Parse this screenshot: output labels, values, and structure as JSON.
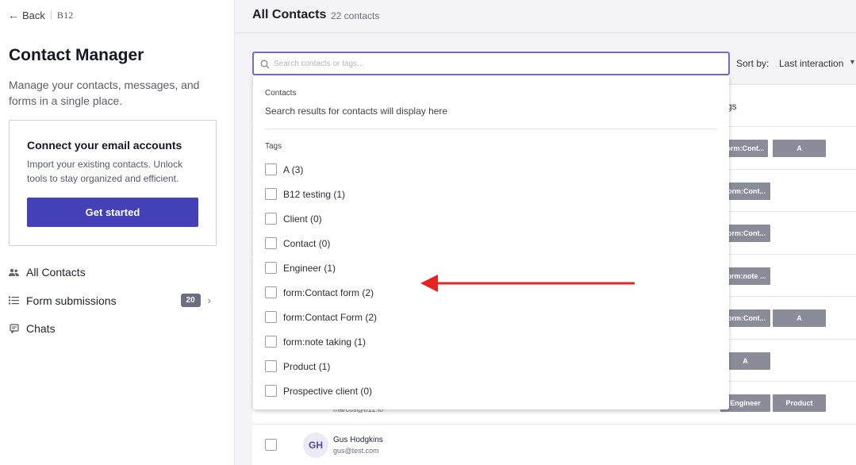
{
  "sidebar": {
    "back_label": "Back",
    "logo": "B12",
    "title": "Contact Manager",
    "description": "Manage your contacts, messages, and forms in a single place.",
    "connect_card": {
      "title": "Connect your email accounts",
      "text": "Import your existing contacts. Unlock tools to stay organized and efficient.",
      "button": "Get started"
    },
    "nav": [
      {
        "label": "All Contacts",
        "icon": "people-icon"
      },
      {
        "label": "Form submissions",
        "icon": "list-icon",
        "badge": "20"
      },
      {
        "label": "Chats",
        "icon": "chat-icon"
      }
    ]
  },
  "main": {
    "title": "All Contacts",
    "count": "22 contacts",
    "sort_label": "Sort by:",
    "sort_value": "Last interaction",
    "tags_header": "gs",
    "rows": [
      {
        "tags": [
          "form:Cont...",
          "A"
        ]
      },
      {
        "tags": [
          "form:Cont..."
        ]
      },
      {
        "tags": [
          "form:Cont..."
        ]
      },
      {
        "tags": [
          "form:note ..."
        ]
      },
      {
        "tags": [
          "form:Cont...",
          "A"
        ]
      },
      {
        "tags": [
          "A"
        ]
      },
      {
        "tags": [
          "Engineer",
          "Product"
        ],
        "email_partial": "marcus@b12.io"
      },
      {
        "initials": "GH",
        "name": "Gus Hodgkins",
        "email": "gus@test.com"
      }
    ]
  },
  "search": {
    "placeholder": "Search contacts or tags...",
    "value": ""
  },
  "dropdown": {
    "contacts_heading": "Contacts",
    "contacts_hint": "Search results for contacts will display here",
    "tags_heading": "Tags",
    "tags": [
      "A (3)",
      "B12 testing (1)",
      "Client (0)",
      "Contact (0)",
      "Engineer (1)",
      "form:Contact form (2)",
      "form:Contact Form (2)",
      "form:note taking (1)",
      "Product (1)",
      "Prospective client (0)"
    ]
  },
  "colors": {
    "accent": "#4340b8",
    "focus_border": "#6f6cd3",
    "tag_chip": "#8a8c99",
    "annotation_arrow": "#e52421"
  }
}
